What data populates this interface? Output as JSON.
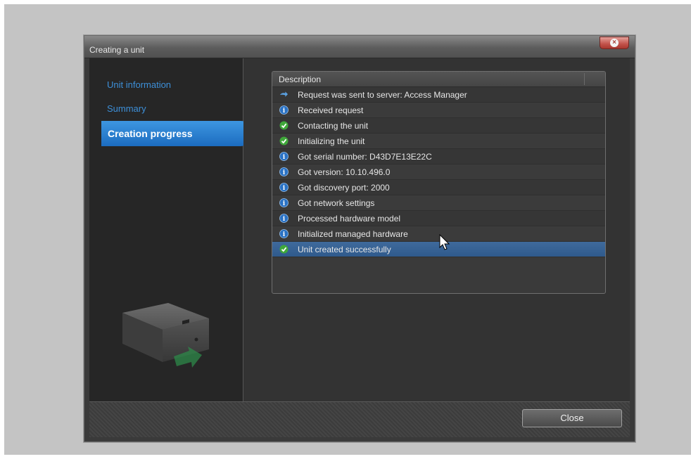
{
  "window": {
    "title": "Creating a unit",
    "close_glyph": "×"
  },
  "sidebar": {
    "items": [
      {
        "label": "Unit information"
      },
      {
        "label": "Summary"
      },
      {
        "label": "Creation progress"
      }
    ],
    "active_index": 2
  },
  "grid": {
    "column_header": "Description",
    "rows": [
      {
        "icon": "arrow-right-icon",
        "text": "Request was sent to server: Access Manager"
      },
      {
        "icon": "info-icon",
        "text": "Received request"
      },
      {
        "icon": "check-icon",
        "text": "Contacting the unit"
      },
      {
        "icon": "check-icon",
        "text": "Initializing the unit"
      },
      {
        "icon": "info-icon",
        "text": "Got serial number: D43D7E13E22C"
      },
      {
        "icon": "info-icon",
        "text": "Got version: 10.10.496.0"
      },
      {
        "icon": "info-icon",
        "text": "Got discovery port: 2000"
      },
      {
        "icon": "info-icon",
        "text": "Got network settings"
      },
      {
        "icon": "info-icon",
        "text": "Processed hardware model"
      },
      {
        "icon": "info-icon",
        "text": "Initialized managed hardware"
      },
      {
        "icon": "check-icon",
        "text": "Unit created successfully"
      }
    ],
    "selected_index": 10
  },
  "footer": {
    "close_label": "Close"
  },
  "colors": {
    "accent": "#1c6cc0",
    "nav_link": "#3d8fd8",
    "info_icon": "#2a72c4",
    "check_icon": "#3fa83a"
  }
}
